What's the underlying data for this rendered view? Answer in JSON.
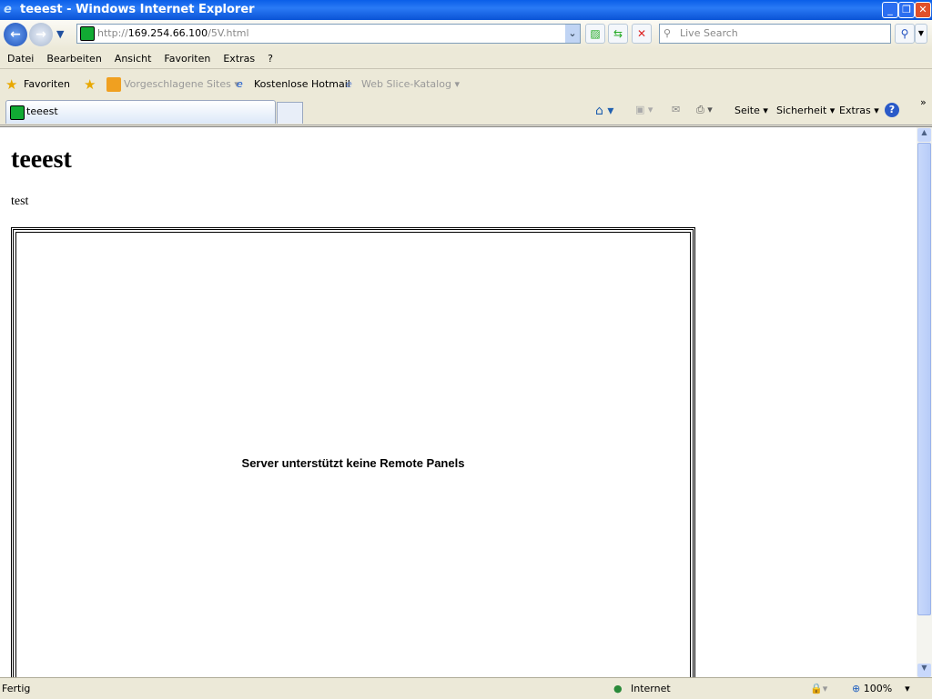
{
  "window": {
    "title": "teeest - Windows Internet Explorer"
  },
  "address": {
    "prefix": "http://",
    "host": "169.254.66.100",
    "path": "/5V.html"
  },
  "search": {
    "placeholder": "Live Search"
  },
  "menu": [
    "Datei",
    "Bearbeiten",
    "Ansicht",
    "Favoriten",
    "Extras",
    "?"
  ],
  "favorites": {
    "label": "Favoriten",
    "items": [
      "Vorgeschlagene Sites",
      "Kostenlose Hotmail",
      "Web Slice-Katalog"
    ]
  },
  "tab": {
    "title": "teeest"
  },
  "commandbar": {
    "page": "Seite",
    "security": "Sicherheit",
    "tools": "Extras"
  },
  "page": {
    "heading": "teeest",
    "text": "test",
    "panel_message": "Server unterstützt keine Remote Panels"
  },
  "status": {
    "text": "Fertig",
    "zone": "Internet",
    "zoom": "100%"
  }
}
